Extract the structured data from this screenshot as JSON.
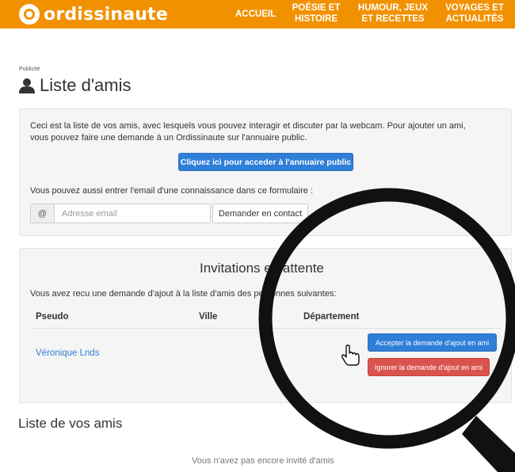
{
  "header": {
    "brand": "ordissinaute",
    "nav": [
      "ACCUEIL",
      "POÉSIE ET\nHISTOIRE",
      "HUMOUR, JEUX\nET RECETTES",
      "VOYAGES ET\nACTUALITÉS"
    ],
    "color": "#f29100"
  },
  "ad_label": "Publicité",
  "page_title": "Liste d'amis",
  "intro": {
    "line1": "Ceci est la liste de vos amis, avec lesquels vous pouvez interagir et discuter par la webcam. Pour ajouter un ami,",
    "line2": "vous pouvez faire une demande à un Ordissinaute sur l'annuaire public.",
    "directory_button": "Cliquez ici pour acceder à l'annuaire public",
    "email_prompt": "Vous pouvez aussi entrer l'email d'une connaissance dans ce formulaire :",
    "email_addon": "@",
    "email_placeholder": "Adresse email",
    "request_button": "Demander en contact"
  },
  "invitations": {
    "title": "Invitations en attente",
    "description": "Vous avez recu une demande d'ajout à la liste d'amis des personnes suivantes:",
    "columns": [
      "Pseudo",
      "Ville",
      "Département"
    ],
    "rows": [
      {
        "pseudo": "Véronique Lnds",
        "ville": "",
        "departement": ""
      }
    ],
    "accept_button": "Accepter la demande d'ajout en ami",
    "ignore_button": "Ignorer la demande d'ajout en ami"
  },
  "friends": {
    "title": "Liste de vos amis",
    "empty_text": "Vous n'avez pas encore invité d'amis"
  },
  "colors": {
    "accent_blue": "#2f7ed8",
    "danger_red": "#d9534f"
  }
}
